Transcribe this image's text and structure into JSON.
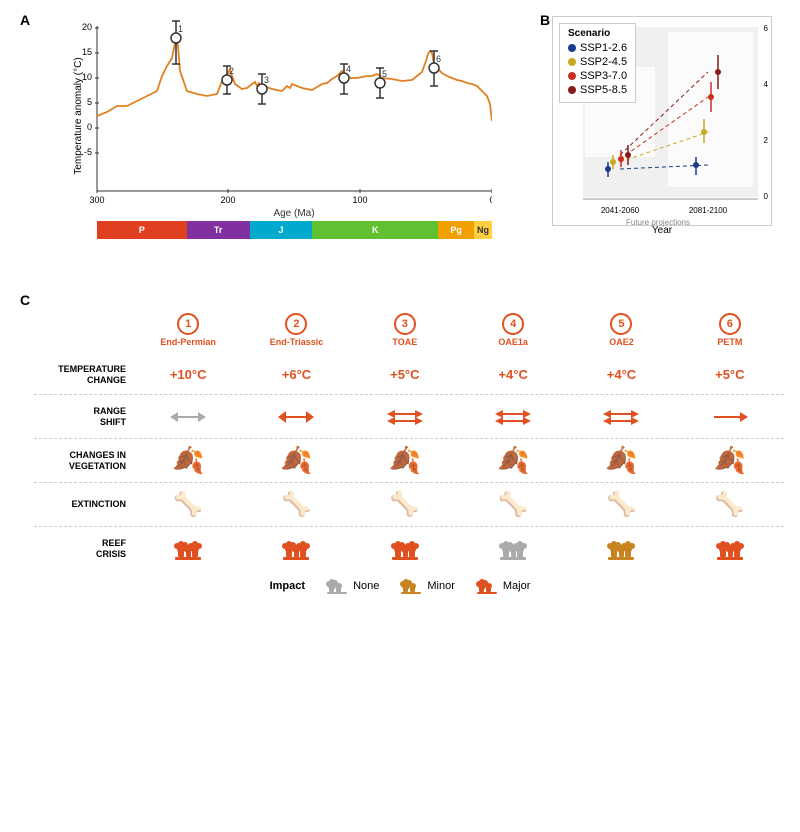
{
  "panels": {
    "a_label": "A",
    "b_label": "B",
    "c_label": "C"
  },
  "panel_a": {
    "y_axis_label": "Temperature anomaly (°C)",
    "x_axis_label": "Age (Ma)",
    "y_ticks": [
      "20",
      "15",
      "10",
      "5",
      "0",
      "-5"
    ],
    "x_ticks": [
      "300",
      "200",
      "100",
      "0"
    ],
    "points": [
      {
        "num": "1",
        "x": 120,
        "y": 24,
        "temp": "+10°C"
      },
      {
        "num": "2",
        "x": 198,
        "y": 52,
        "temp": "+6°C"
      },
      {
        "num": "3",
        "x": 227,
        "y": 70,
        "temp": "+5°C"
      },
      {
        "num": "4",
        "x": 282,
        "y": 52,
        "temp": "+4°C"
      },
      {
        "num": "5",
        "x": 318,
        "y": 58,
        "temp": "+4°C"
      },
      {
        "num": "6",
        "x": 372,
        "y": 42,
        "temp": "+5°C"
      }
    ]
  },
  "panel_b": {
    "title": "Scenario",
    "x_label": "Year",
    "x_ticks": [
      "2041-2060",
      "2081-2100"
    ],
    "y_ticks": [
      "6",
      "4",
      "2",
      "0"
    ],
    "future_label": "Future projections",
    "scenarios": [
      {
        "name": "SSP1-2.6",
        "color": "#1a3a8a"
      },
      {
        "name": "SSP2-4.5",
        "color": "#c8a820"
      },
      {
        "name": "SSP3-7.0",
        "color": "#c83020"
      },
      {
        "name": "SSP5-8.5",
        "color": "#8b1a1a"
      }
    ]
  },
  "geo_periods": [
    {
      "name": "P",
      "color": "#e04020",
      "flex": 10
    },
    {
      "name": "Tr",
      "color": "#8030a0",
      "flex": 7
    },
    {
      "name": "J",
      "color": "#00aacc",
      "flex": 7
    },
    {
      "name": "K",
      "color": "#60c030",
      "flex": 14
    },
    {
      "name": "Pg",
      "color": "#f0a000",
      "flex": 4
    },
    {
      "name": "Ng",
      "color": "#ffd040",
      "flex": 2
    }
  ],
  "events": [
    {
      "number": "1",
      "name": "End-Permian"
    },
    {
      "number": "2",
      "name": "End-Triassic"
    },
    {
      "number": "3",
      "name": "TOAE"
    },
    {
      "number": "4",
      "name": "OAE1a"
    },
    {
      "number": "5",
      "name": "OAE2"
    },
    {
      "number": "6",
      "name": "PETM"
    }
  ],
  "categories": [
    {
      "label": "TEMPERATURE\nCHANGE",
      "values": [
        "+10°C",
        "+6°C",
        "+5°C",
        "+4°C",
        "+4°C",
        "+5°C"
      ],
      "type": "text"
    },
    {
      "label": "RANGE\nSHIFT",
      "values": [
        "major",
        "major",
        "major",
        "major",
        "major",
        "major"
      ],
      "type": "arrow",
      "colors": [
        "#aaa",
        "#e05020",
        "#e05020",
        "#e05020",
        "#e05020",
        "#e05020"
      ]
    },
    {
      "label": "CHANGES IN\nVEGETATION",
      "values": [
        "major",
        "major",
        "major",
        "none",
        "none",
        "major"
      ],
      "type": "leaf",
      "colors": [
        "#e05020",
        "#e05020",
        "#e05020",
        "#aaa",
        "#aaa",
        "#e05020"
      ]
    },
    {
      "label": "EXTINCTION",
      "values": [
        "major",
        "major",
        "minor",
        "minor",
        "minor",
        "minor"
      ],
      "type": "skull",
      "colors": [
        "#e05020",
        "#e05020",
        "#c8841e",
        "#e05020",
        "#c8841e",
        "#c8841e"
      ]
    },
    {
      "label": "REEF\nCRISIS",
      "values": [
        "major",
        "major",
        "major",
        "none",
        "minor",
        "major"
      ],
      "type": "reef",
      "colors": [
        "#e05020",
        "#e05020",
        "#e05020",
        "#aaa",
        "#c8841e",
        "#e05020"
      ]
    }
  ],
  "legend": {
    "impact_label": "Impact",
    "none_label": "None",
    "minor_label": "Minor",
    "major_label": "Major"
  }
}
